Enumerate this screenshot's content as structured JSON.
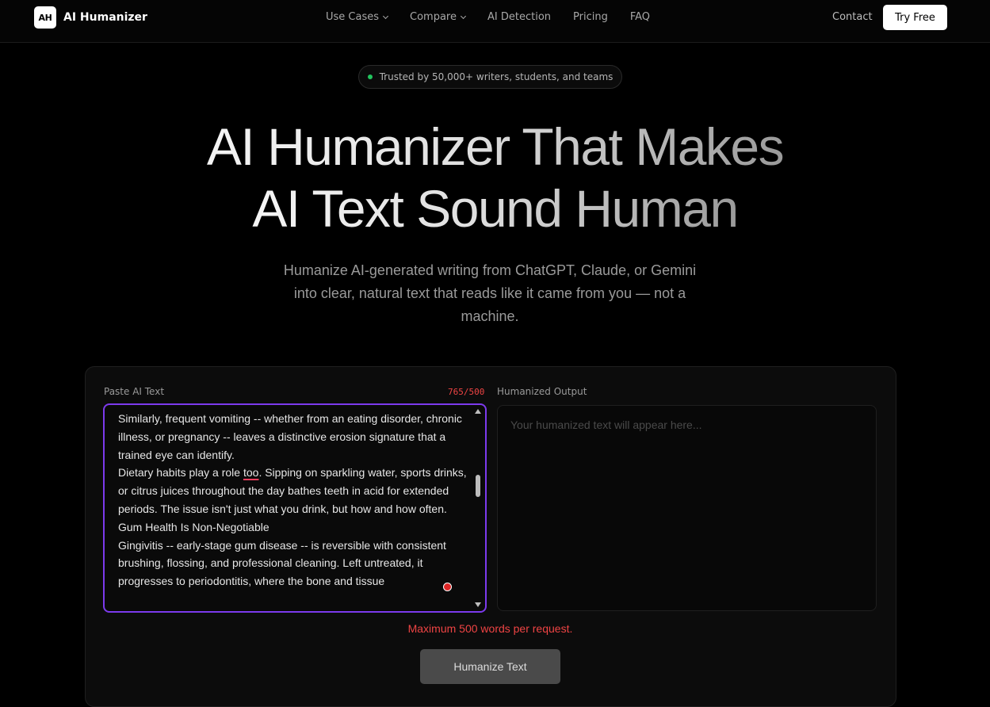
{
  "nav": {
    "logo_badge": "AH",
    "brand": "AI Humanizer",
    "links": [
      {
        "label": "Use Cases",
        "dropdown": true
      },
      {
        "label": "Compare",
        "dropdown": true
      },
      {
        "label": "AI Detection",
        "dropdown": false
      },
      {
        "label": "Pricing",
        "dropdown": false
      },
      {
        "label": "FAQ",
        "dropdown": false
      }
    ],
    "contact": "Contact",
    "cta": "Try Free"
  },
  "hero": {
    "badge": "Trusted by 50,000+ writers, students, and teams",
    "title_line1": "AI Humanizer That Makes",
    "title_line2": "AI Text Sound Human",
    "subtitle": "Humanize AI-generated writing from ChatGPT, Claude, or Gemini into clear, natural text that reads like it came from you — not a machine."
  },
  "tool": {
    "input_label": "Paste AI Text",
    "word_counter": "765/500",
    "input_paragraphs": [
      "Similarly, frequent vomiting -- whether from an eating disorder, chronic illness, or pregnancy -- leaves a distinctive erosion signature that a trained eye can identify.",
      "Gum Health Is Non-Negotiable",
      "Gingivitis -- early-stage gum disease -- is reversible with consistent brushing, flossing, and professional cleaning. Left untreated, it progresses to periodontitis, where the bone and tissue"
    ],
    "dietary_pre": "Dietary habits play a role ",
    "dietary_flagged": "too",
    "dietary_post": ". Sipping on sparkling water, sports drinks, or citrus juices throughout the day bathes teeth in acid for extended periods. The issue isn't just what you drink, but how and how often.",
    "output_label": "Humanized Output",
    "output_placeholder": "Your humanized text will appear here...",
    "error_message": "Maximum 500 words per request.",
    "submit_label": "Humanize Text"
  },
  "colors": {
    "accent_border": "#7c3aed",
    "error": "#ef4444",
    "status_dot": "#22c55e"
  }
}
